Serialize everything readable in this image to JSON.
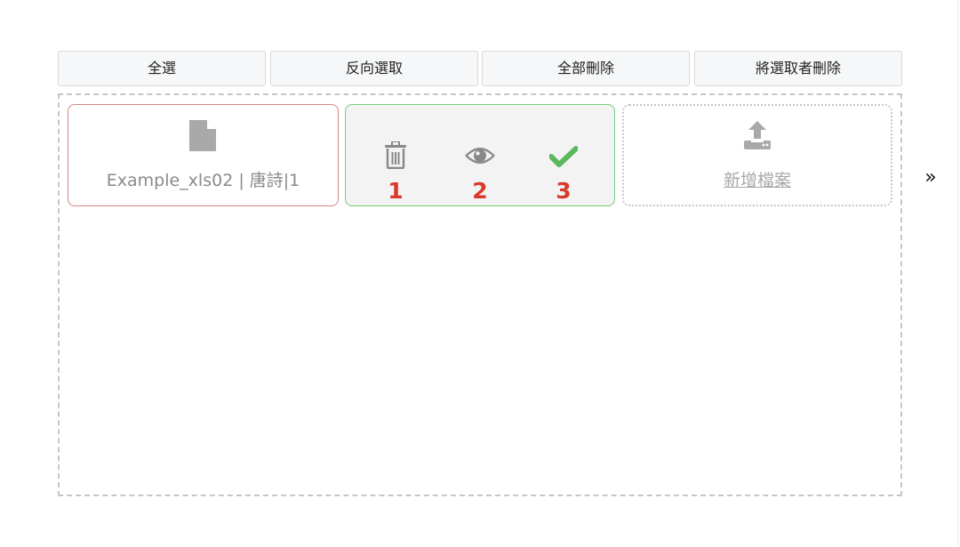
{
  "toolbar": {
    "select_all_label": "全選",
    "invert_selection_label": "反向選取",
    "delete_all_label": "全部刪除",
    "delete_selected_label": "將選取者刪除"
  },
  "files": [
    {
      "name": "Example_xls02 | 唐詩|1",
      "icon": "file-icon"
    }
  ],
  "actions": [
    {
      "icon": "trash-icon",
      "number": "1"
    },
    {
      "icon": "eye-icon",
      "number": "2"
    },
    {
      "icon": "check-icon",
      "number": "3"
    }
  ],
  "add_file": {
    "icon": "upload-icon",
    "label": "新增檔案"
  },
  "pager": {
    "next_icon": "double-chevron-right-icon",
    "next_label": "»"
  },
  "colors": {
    "annotation_red": "#d9392b",
    "check_green": "#5cb85c",
    "selected_border": "#77cc77",
    "file_border": "#d98585"
  }
}
